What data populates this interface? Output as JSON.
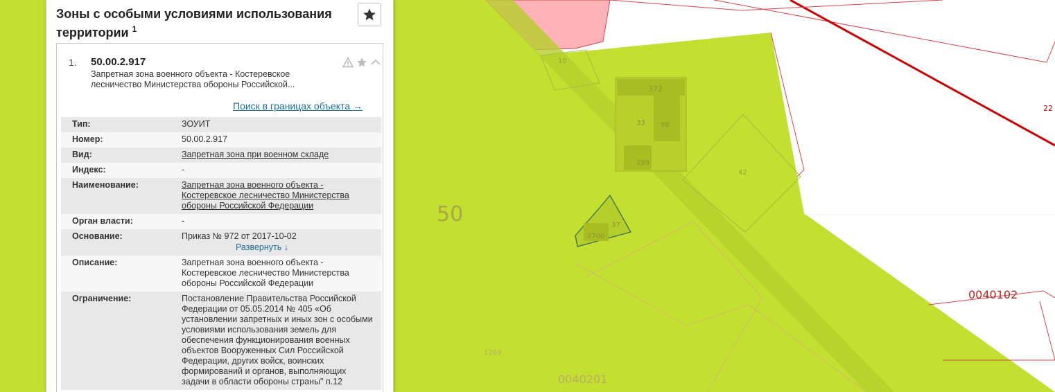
{
  "panel": {
    "title": "Зоны с особыми условиями использования территории",
    "title_footnote": "1",
    "favorite_icon": "star-icon"
  },
  "item": {
    "index": "1.",
    "number": "50.00.2.917",
    "subtitle": "Запретная зона военного объекта - Костеревское лесничество Министерства обороны Российской...",
    "icons": [
      "warning-icon",
      "star-icon",
      "chevron-up-icon"
    ],
    "search_link": "Поиск в границах объекта →",
    "properties": {
      "type": {
        "label": "Тип:",
        "value": "ЗОУИТ"
      },
      "number": {
        "label": "Номер:",
        "value": "50.00.2.917"
      },
      "kind": {
        "label": "Вид:",
        "value": "Запретная зона при военном складе"
      },
      "index": {
        "label": "Индекс:",
        "value": "-"
      },
      "name": {
        "label": "Наименование:",
        "value": "Запретная зона военного объекта - Костеревское лесничество Министерства обороны Российской Федерации"
      },
      "authority": {
        "label": "Орган власти:",
        "value": "-"
      },
      "basis": {
        "label": "Основание:",
        "value": "Приказ № 972 от 2017-10-02",
        "expand": "Развернуть ↓"
      },
      "description": {
        "label": "Описание:",
        "value": "Запретная зона военного объекта - Костеревское лесничество Министерства обороны Российской Федерации"
      },
      "restriction": {
        "label": "Ограничение:",
        "value": "Постановление Правительства Российской Федерации от 05.05.2014 № 405 «Об установлении запретных и иных зон с особыми условиями использования земель для обеспечения функционирования военных объектов Вооруженных Сил Российской Федерации, других войск, воинских формирований и органов, выполняющих задачи в области обороны страны\" п.12"
      }
    }
  },
  "map": {
    "zone_color": "#c3df2f",
    "parcel_color": "#ffb3b6",
    "boundary_color": "#cc0000",
    "labels": {
      "quarter_50": "50",
      "parcel_10": "10",
      "parcel_372": "372",
      "parcel_33": "33",
      "parcel_98": "98",
      "parcel_299": "299",
      "parcel_42": "42",
      "parcel_37": "37",
      "parcel_2700": "2700",
      "parcel_22": "22",
      "block_0040102": "0040102",
      "block_0040201": "0040201",
      "parcel_1269": "1269"
    }
  }
}
